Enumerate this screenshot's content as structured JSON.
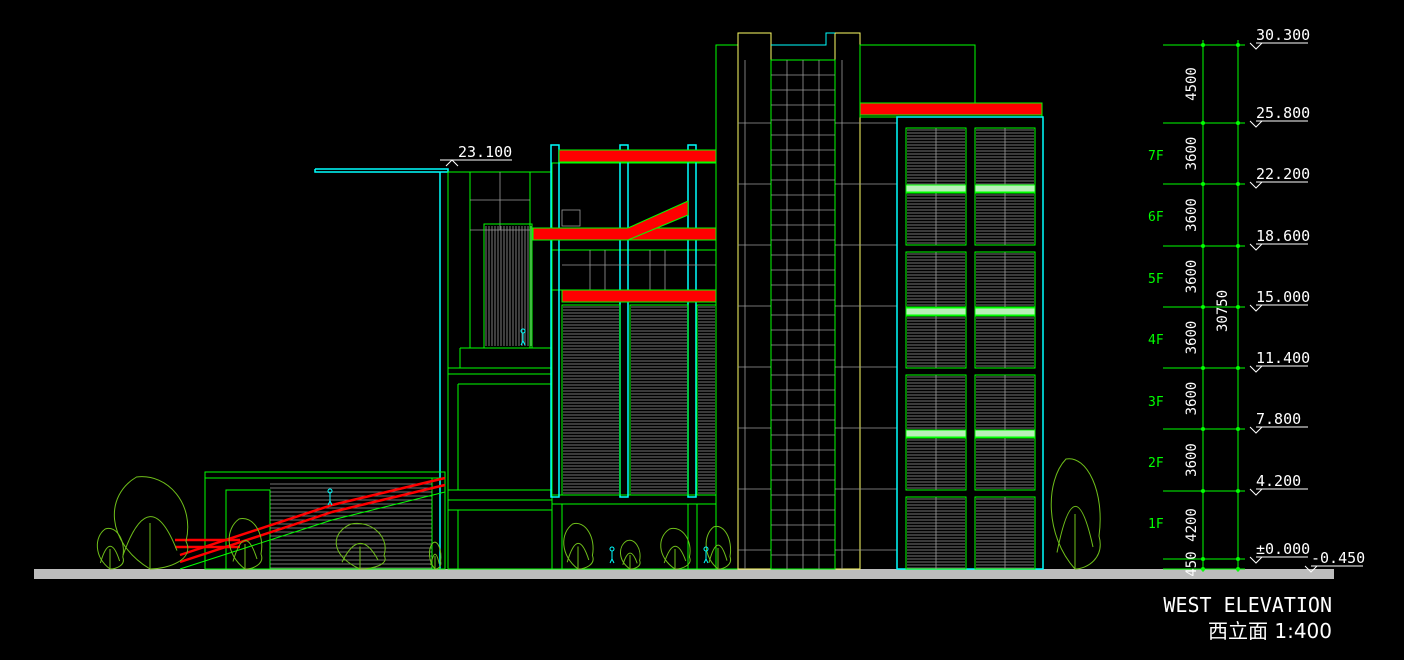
{
  "drawing": {
    "title_en": "WEST ELEVATION",
    "title_cn": "西立面 1:400",
    "roof_level_label": "23.100"
  },
  "levels": [
    {
      "elev": "30.300"
    },
    {
      "elev": "25.800"
    },
    {
      "elev": "22.200"
    },
    {
      "elev": "18.600"
    },
    {
      "elev": "15.000"
    },
    {
      "elev": "11.400"
    },
    {
      "elev": "7.800"
    },
    {
      "elev": "4.200"
    },
    {
      "elev": "±0.000"
    },
    {
      "elev": "-0.450"
    }
  ],
  "floor_heights": [
    "4500",
    "3600",
    "3600",
    "3600",
    "3600",
    "3600",
    "3600",
    "4200",
    "450"
  ],
  "floors": [
    "7F",
    "6F",
    "5F",
    "4F",
    "3F",
    "2F",
    "1F"
  ],
  "total_height": "30750",
  "colors": {
    "green": "#00ff00",
    "cyan": "#00ffff",
    "red": "#ff0000",
    "yellow": "#ffff66",
    "white": "#ffffff",
    "grey": "#9a9a9a",
    "ground": "#bdbdbd",
    "tree": "#6fbf1a"
  }
}
